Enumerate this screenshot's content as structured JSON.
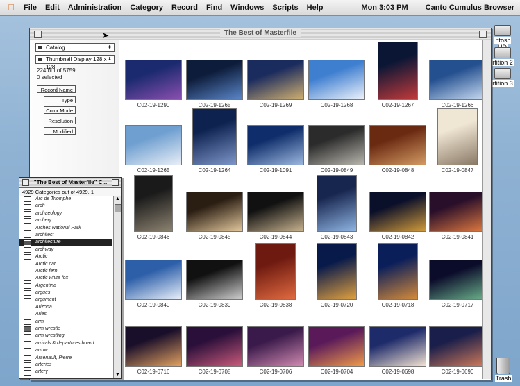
{
  "menubar": {
    "items": [
      "File",
      "Edit",
      "Administration",
      "Category",
      "Record",
      "Find",
      "Windows",
      "Scripts",
      "Help"
    ],
    "clock": "Mon 3:03 PM",
    "app_name": "Canto Cumulus Browser"
  },
  "desktop": {
    "drives": [
      "ntosh HD",
      "rtition 2",
      "rtition 3"
    ],
    "trash": "Trash"
  },
  "window": {
    "title": "The Best of Masterfile",
    "catalog_select": "Catalog",
    "display_select": "Thumbnail Display 128 x 128",
    "count_text": "224 out of 5759",
    "selected_text": "0 selected",
    "buttons": [
      "Record Name",
      "Type",
      "Color Mode",
      "Resolution",
      "Modified"
    ]
  },
  "thumbnails": [
    {
      "id": "C02-19-1290",
      "c1": "#1b2a6e",
      "c2": "#8a4fb0",
      "w": 80,
      "h": 56
    },
    {
      "id": "C02-19-1265",
      "c1": "#0d1c3a",
      "c2": "#5a86c9",
      "w": 80,
      "h": 56
    },
    {
      "id": "C02-19-1269",
      "c1": "#1a2b5e",
      "c2": "#d0b070",
      "w": 80,
      "h": 56
    },
    {
      "id": "C02-19-1268",
      "c1": "#3f7fd0",
      "c2": "#eef3fb",
      "w": 80,
      "h": 56
    },
    {
      "id": "C02-19-1267",
      "c1": "#0b1635",
      "c2": "#c23a3a",
      "w": 56,
      "h": 82
    },
    {
      "id": "C02-19-1266",
      "c1": "#24508f",
      "c2": "#c9dbf2",
      "w": 80,
      "h": 56
    },
    {
      "id": "C02-19-1265",
      "c1": "#6f9fd0",
      "c2": "#e8eef6",
      "w": 80,
      "h": 56
    },
    {
      "id": "C02-19-1264",
      "c1": "#0e2250",
      "c2": "#7c95c8",
      "w": 62,
      "h": 80
    },
    {
      "id": "C02-19-1091",
      "c1": "#0f2d6a",
      "c2": "#9bb7df",
      "w": 80,
      "h": 56
    },
    {
      "id": "C02-19-0849",
      "c1": "#2b2b2b",
      "c2": "#b8b6ad",
      "w": 80,
      "h": 56
    },
    {
      "id": "C02-19-0848",
      "c1": "#6a2a12",
      "c2": "#d39a62",
      "w": 80,
      "h": 56
    },
    {
      "id": "C02-19-0847",
      "c1": "#f0e6d4",
      "c2": "#8a7a66",
      "w": 56,
      "h": 80
    },
    {
      "id": "C02-19-0846",
      "c1": "#1a1a1a",
      "c2": "#8c8270",
      "w": 54,
      "h": 80
    },
    {
      "id": "C02-19-0845",
      "c1": "#2a1d12",
      "c2": "#e2c79c",
      "w": 80,
      "h": 56
    },
    {
      "id": "C02-19-0844",
      "c1": "#111",
      "c2": "#c7b28e",
      "w": 80,
      "h": 56
    },
    {
      "id": "C02-19-0843",
      "c1": "#17264f",
      "c2": "#8fb4e2",
      "w": 56,
      "h": 80
    },
    {
      "id": "C02-19-0842",
      "c1": "#0a0f2a",
      "c2": "#d09a3a",
      "w": 80,
      "h": 56
    },
    {
      "id": "C02-19-0841",
      "c1": "#2a0f2a",
      "c2": "#e07a40",
      "w": 80,
      "h": 56
    },
    {
      "id": "C02-19-0840",
      "c1": "#2d5fa8",
      "c2": "#e9f0fb",
      "w": 80,
      "h": 56
    },
    {
      "id": "C02-19-0839",
      "c1": "#111",
      "c2": "#cfcfcf",
      "w": 80,
      "h": 56
    },
    {
      "id": "C02-19-0838",
      "c1": "#6e1a10",
      "c2": "#e06a40",
      "w": 56,
      "h": 80
    },
    {
      "id": "C02-19-0720",
      "c1": "#081a4a",
      "c2": "#e0a040",
      "w": 56,
      "h": 80
    },
    {
      "id": "C02-19-0718",
      "c1": "#0a1e5a",
      "c2": "#d48a3a",
      "w": 56,
      "h": 80
    },
    {
      "id": "C02-19-0717",
      "c1": "#0b0b2a",
      "c2": "#6ab08a",
      "w": 80,
      "h": 56
    },
    {
      "id": "C02-19-0716",
      "c1": "#1a0f2a",
      "c2": "#e0a060",
      "w": 80,
      "h": 56
    },
    {
      "id": "C02-19-0708",
      "c1": "#2a0f3a",
      "c2": "#c95a7a",
      "w": 80,
      "h": 56
    },
    {
      "id": "C02-19-0706",
      "c1": "#3a1a4a",
      "c2": "#d08ab0",
      "w": 80,
      "h": 56
    },
    {
      "id": "C02-19-0704",
      "c1": "#5a1a5a",
      "c2": "#f09a4a",
      "w": 80,
      "h": 56
    },
    {
      "id": "C02-19-0698",
      "c1": "#1e2b6a",
      "c2": "#f0e0d0",
      "w": 80,
      "h": 56
    },
    {
      "id": "C02-19-0690",
      "c1": "#1a1e4a",
      "c2": "#d07a5a",
      "w": 80,
      "h": 56
    }
  ],
  "categories": {
    "title": "\"The Best of Masterfile\" C...",
    "header": "4929 Categories out of 4929, 1",
    "items": [
      {
        "label": "Arc de Triomphe"
      },
      {
        "label": "arch"
      },
      {
        "label": "archaeology"
      },
      {
        "label": "archery"
      },
      {
        "label": "Arches National Park"
      },
      {
        "label": "architect"
      },
      {
        "label": "architecture",
        "selected": true
      },
      {
        "label": "archway"
      },
      {
        "label": "Arctic"
      },
      {
        "label": "Arctic cat"
      },
      {
        "label": "Arctic fern"
      },
      {
        "label": "Arctic white fox"
      },
      {
        "label": "Argentina"
      },
      {
        "label": "argues"
      },
      {
        "label": "argument"
      },
      {
        "label": "Arizona"
      },
      {
        "label": "Arles"
      },
      {
        "label": "arm"
      },
      {
        "label": "arm wrestle",
        "dark": true
      },
      {
        "label": "arm wrestling"
      },
      {
        "label": "arrivals & departures board"
      },
      {
        "label": "arrow"
      },
      {
        "label": "Arsenault, Pierre"
      },
      {
        "label": "arteries"
      },
      {
        "label": "artery"
      }
    ]
  }
}
